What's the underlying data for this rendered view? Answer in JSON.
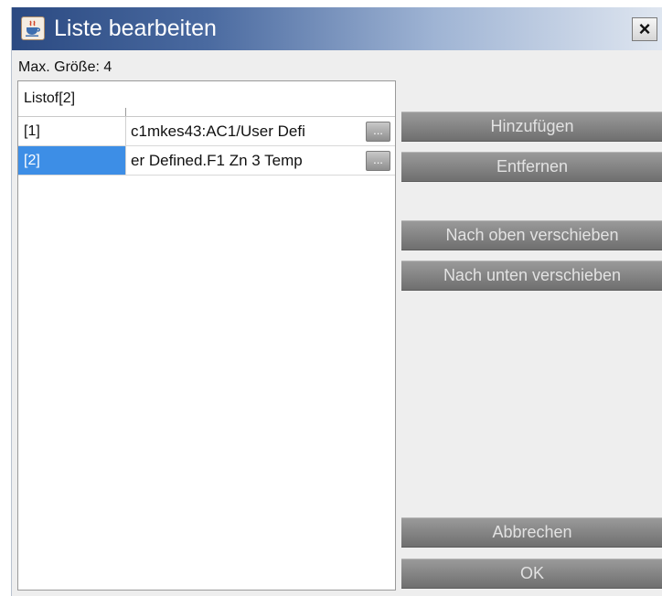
{
  "window": {
    "title": "Liste bearbeiten",
    "close_label": "×",
    "icon": "java-cup-icon"
  },
  "max_size_label": "Max. Größe: 4",
  "table": {
    "column_header": "Listof[2]",
    "rows": [
      {
        "index": "[1]",
        "value": "c1mkes43:AC1/User Defi",
        "button_label": "...",
        "selected": false
      },
      {
        "index": "[2]",
        "value": "er Defined.F1 Zn 3 Temp",
        "button_label": "...",
        "selected": true
      }
    ]
  },
  "buttons": {
    "add": "Hinzufügen",
    "remove": "Entfernen",
    "move_up": "Nach oben verschieben",
    "move_down": "Nach unten verschieben",
    "cancel": "Abbrechen",
    "ok": "OK"
  },
  "colors": {
    "selection": "#3d8ee6",
    "titlebar_dark": "#2b4a82",
    "button_gray": "#7f7f7f"
  }
}
